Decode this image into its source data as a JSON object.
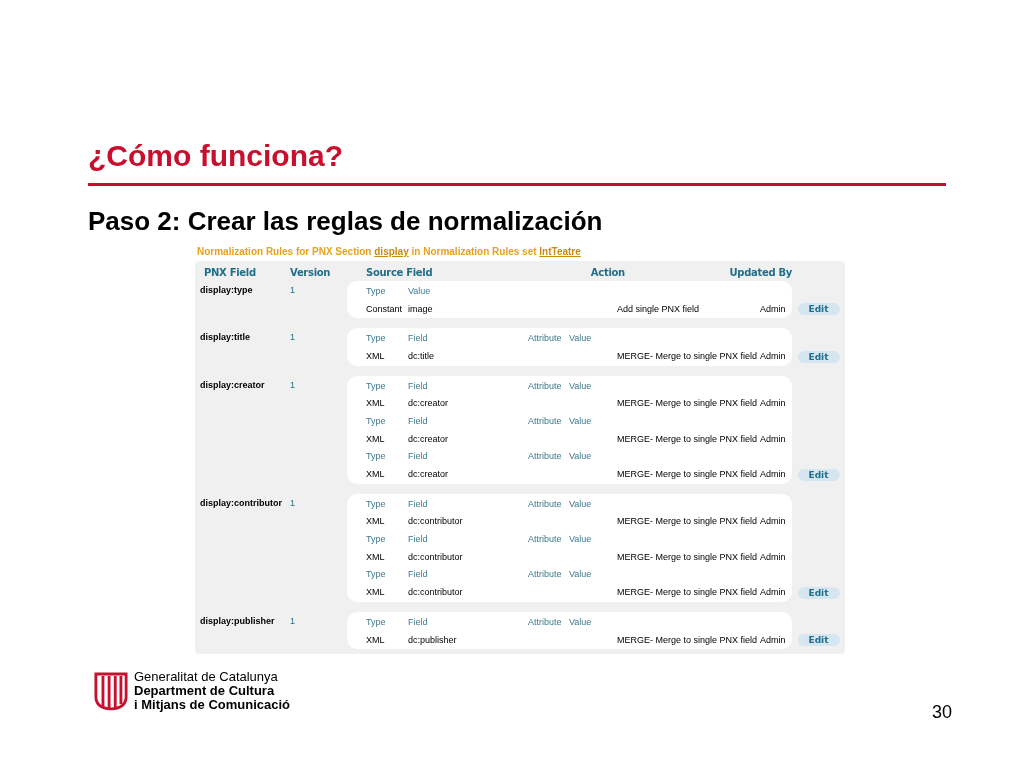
{
  "slide": {
    "title": "¿Cómo funciona?",
    "subtitle": "Paso 2: Crear las reglas de normalización",
    "page_number": "30"
  },
  "screenshot": {
    "heading": [
      {
        "text": "Normalization Rules for PNX Section ",
        "link": false
      },
      {
        "text": "display",
        "link": true
      },
      {
        "text": " in Normalization Rules set ",
        "link": false
      },
      {
        "text": "IntTeatre",
        "link": true
      }
    ],
    "columns": [
      "PNX Field",
      "Version",
      "Source Field",
      "Action",
      "Updated By"
    ],
    "rules": [
      {
        "pnx_field": "display:type",
        "version": "1",
        "edit": "Edit",
        "sources": [
          {
            "labels": [
              "Type",
              "Value"
            ],
            "type": "Constant",
            "field": "image",
            "action": "Add single PNX field",
            "updated_by": "Admin"
          }
        ]
      },
      {
        "pnx_field": "display:title",
        "version": "1",
        "edit": "Edit",
        "sources": [
          {
            "labels": [
              "Type",
              "Field",
              "Attribute",
              "Value"
            ],
            "type": "XML",
            "field": "dc:title",
            "action": "MERGE- Merge to single PNX field",
            "updated_by": "Admin"
          }
        ]
      },
      {
        "pnx_field": "display:creator",
        "version": "1",
        "edit": "Edit",
        "sources": [
          {
            "labels": [
              "Type",
              "Field",
              "Attribute",
              "Value"
            ],
            "type": "XML",
            "field": "dc:creator",
            "action": "MERGE- Merge to single PNX field",
            "updated_by": "Admin"
          },
          {
            "labels": [
              "Type",
              "Field",
              "Attribute",
              "Value"
            ],
            "type": "XML",
            "field": "dc:creator",
            "action": "MERGE- Merge to single PNX field",
            "updated_by": "Admin"
          },
          {
            "labels": [
              "Type",
              "Field",
              "Attribute",
              "Value"
            ],
            "type": "XML",
            "field": "dc:creator",
            "action": "MERGE- Merge to single PNX field",
            "updated_by": "Admin"
          }
        ]
      },
      {
        "pnx_field": "display:contributor",
        "version": "1",
        "edit": "Edit",
        "sources": [
          {
            "labels": [
              "Type",
              "Field",
              "Attribute",
              "Value"
            ],
            "type": "XML",
            "field": "dc:contributor",
            "action": "MERGE- Merge to single PNX field",
            "updated_by": "Admin"
          },
          {
            "labels": [
              "Type",
              "Field",
              "Attribute",
              "Value"
            ],
            "type": "XML",
            "field": "dc:contributor",
            "action": "MERGE- Merge to single PNX field",
            "updated_by": "Admin"
          },
          {
            "labels": [
              "Type",
              "Field",
              "Attribute",
              "Value"
            ],
            "type": "XML",
            "field": "dc:contributor",
            "action": "MERGE- Merge to single PNX field",
            "updated_by": "Admin"
          }
        ]
      },
      {
        "pnx_field": "display:publisher",
        "version": "1",
        "edit": "Edit",
        "sources": [
          {
            "labels": [
              "Type",
              "Field",
              "Attribute",
              "Value"
            ],
            "type": "XML",
            "field": "dc:publisher",
            "action": "MERGE- Merge to single PNX field",
            "updated_by": "Admin"
          }
        ]
      }
    ]
  },
  "footer": {
    "logo_lines": [
      "Generalitat de Catalunya",
      "Department de Cultura",
      "i Mitjans de Comunicació"
    ]
  }
}
